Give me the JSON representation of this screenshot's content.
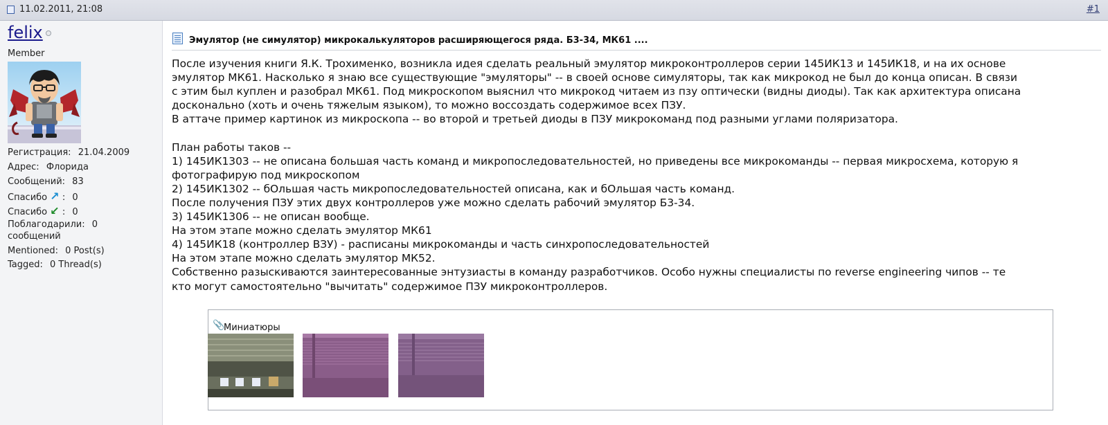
{
  "header": {
    "date": "11.02.2011, 21:08",
    "post_number": "#1"
  },
  "user": {
    "name": "felix",
    "title": "Member",
    "stats": {
      "registration_label": "Регистрация:",
      "registration_value": "21.04.2009",
      "address_label": "Адрес:",
      "address_value": "Флорида",
      "messages_label": "Сообщений:",
      "messages_value": "83",
      "thanks_given_label": "Спасибо",
      "thanks_given_value": "0",
      "thanks_received_label": "Спасибо",
      "thanks_received_value": "0",
      "thanked_label_1": "Поблагодарили:",
      "thanked_value": "0",
      "thanked_label_2": "сообщений",
      "mentioned_label": "Mentioned:",
      "mentioned_value": "0 Post(s)",
      "tagged_label": "Tagged:",
      "tagged_value": "0 Thread(s)"
    }
  },
  "post": {
    "title": "Эмулятор (не симулятор) микрокалькуляторов расширяющегося ряда. Б3-34, МК61 ....",
    "body_lines": [
      "После изучения книги Я.К. Трохименко, возникла идея сделать реальный эмулятор микроконтроллеров серии 145ИК13 и 145ИК18, и на их основе",
      "эмулятор МК61. Насколько я знаю все существующие \"эмуляторы\" -- в своей основе симуляторы, так как микрокод не был до конца описан. В связи",
      "с этим был куплен и разобрал МК61. Под микроскопом выяснил что микрокод читаем из пзу оптически (видны диоды). Так как архитектура описана",
      "досконально (хоть и очень тяжелым языком), то можно воссоздать содержимое всех ПЗУ.",
      "В аттаче пример картинок из микроскопа -- во второй и третьей диоды в ПЗУ микрокоманд под разными углами поляризатора.",
      "",
      "План работы таков --",
      "1) 145ИК1303 -- не описана большая часть команд и микропоследовательностей, но приведены все микрокоманды -- первая микросхема, которую я",
      "фотографирую под микроскопом",
      "2) 145ИК1302 -- бОльшая часть микропоследовательностей описана, как и бОльшая часть команд.",
      "После получения ПЗУ этих двух контроллеров уже можно сделать рабочий эмулятор Б3-34.",
      "3) 145ИК1306 -- не описан вообще.",
      "На этом этапе можно сделать эмулятор МК61",
      "4) 145ИК18 (контроллер ВЗУ) - расписаны микрокоманды и часть синхропоследовательностей",
      "На этом этапе можно сделать эмулятор МК52.",
      "Собственно разыскиваются заинтересованные энтузиасты в команду разработчиков. Особо нужны специалисты по reverse engineering чипов -- те",
      "кто могут самостоятельно \"вычитать\" содержимое ПЗУ микроконтроллеров."
    ],
    "attachments_label": "Миниатюры"
  }
}
